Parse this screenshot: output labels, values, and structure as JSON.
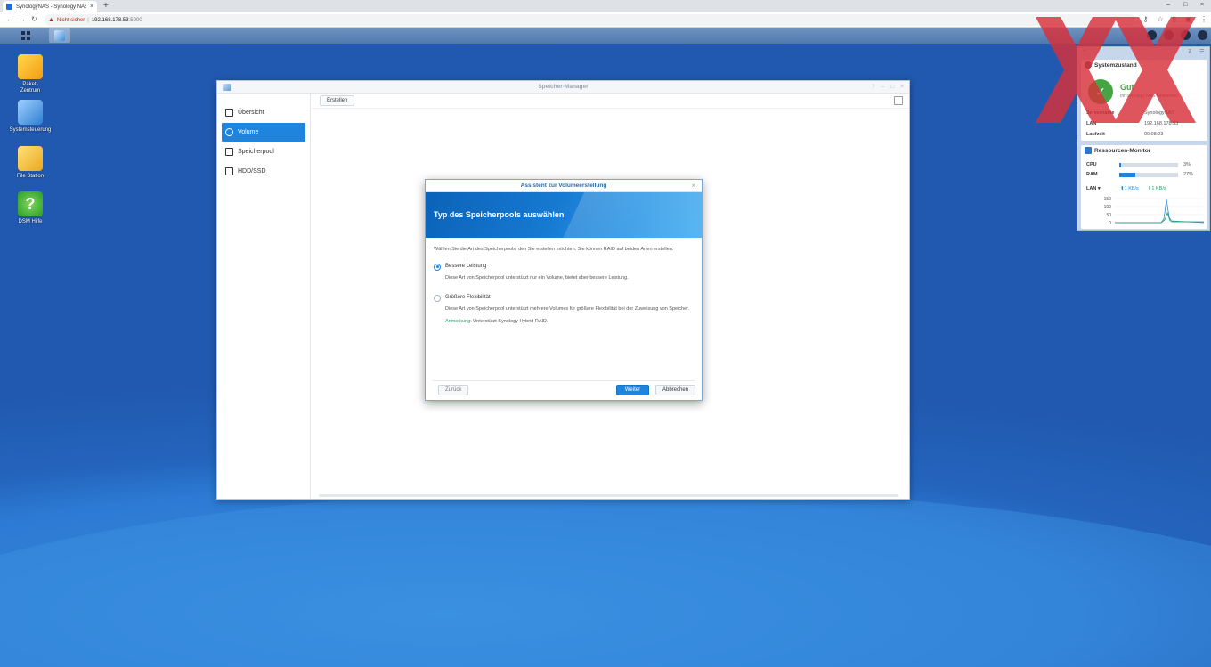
{
  "browser": {
    "tab_title": "SynologyNAS - Synology NAS",
    "tab_close": "×",
    "new_tab": "+",
    "not_secure": "Nicht sicher",
    "separator": "|",
    "url_host": "192.168.178.53",
    "url_port": ":5000",
    "win_min": "–",
    "win_max": "□",
    "win_close": "×"
  },
  "desktop": {
    "icons": [
      {
        "label": "Paket-\nZentrum"
      },
      {
        "label": "Systemsteuerung"
      },
      {
        "label": "File Station"
      },
      {
        "label": "DSM Hilfe",
        "glyph": "?"
      }
    ]
  },
  "window": {
    "title": "Speicher-Manager",
    "sidebar": [
      {
        "label": "Übersicht",
        "active": false
      },
      {
        "label": "Volume",
        "active": true
      },
      {
        "label": "Speicherpool",
        "active": false
      },
      {
        "label": "HDD/SSD",
        "active": false
      }
    ],
    "create_label": "Erstellen",
    "controls": [
      "?",
      "–",
      "□",
      "×"
    ]
  },
  "wizard": {
    "title": "Assistent zur Volumeerstellung",
    "close": "×",
    "heading": "Typ des Speicherpools auswählen",
    "intro": "Wählen Sie die Art des Speicherpools, den Sie erstellen möchten. Sie können RAID auf beiden Arten erstellen.",
    "option1_label": "Bessere Leistung",
    "option1_desc": "Diese Art von Speicherpool unterstützt nur ein Volume, bietet aber bessere Leistung.",
    "option2_label": "Größere Flexibilität",
    "option2_desc": "Diese Art von Speicherpool unterstützt mehrere Volumes für größere Flexibilität bei der Zuweisung von Speicher.",
    "note_label": "Anmerkung:",
    "note_text": " Unterstützt Synology Hybrid RAID.",
    "selected_option": 1,
    "back": "Zurück",
    "next": "Weiter",
    "cancel": "Abbrechen"
  },
  "widgets": {
    "system_title": "Systemzustand",
    "status": "Gut",
    "status_sub": "Ihr Synology NAS funktioniert …",
    "rows": [
      {
        "k": "Servername",
        "v": "SynologyNAS"
      },
      {
        "k": "LAN",
        "v": "192.168.178.53"
      },
      {
        "k": "Laufzeit",
        "v": "00:08:23"
      }
    ],
    "resource_title": "Ressourcen-Monitor",
    "cpu_label": "CPU",
    "cpu_value": "3%",
    "cpu_fraction": 0.03,
    "ram_label": "RAM",
    "ram_value": "27%",
    "ram_fraction": 0.27,
    "lan_label": "LAN ▾",
    "lan_up": "⬆1 KB/s",
    "lan_down": "⬇1 KB/s",
    "graph_ticks": [
      "150",
      "100",
      "50",
      "0"
    ]
  },
  "colors": {
    "accent": "#1f84dd",
    "ok": "#45a545",
    "note": "#22a36a",
    "watermark": "#d9303a"
  }
}
